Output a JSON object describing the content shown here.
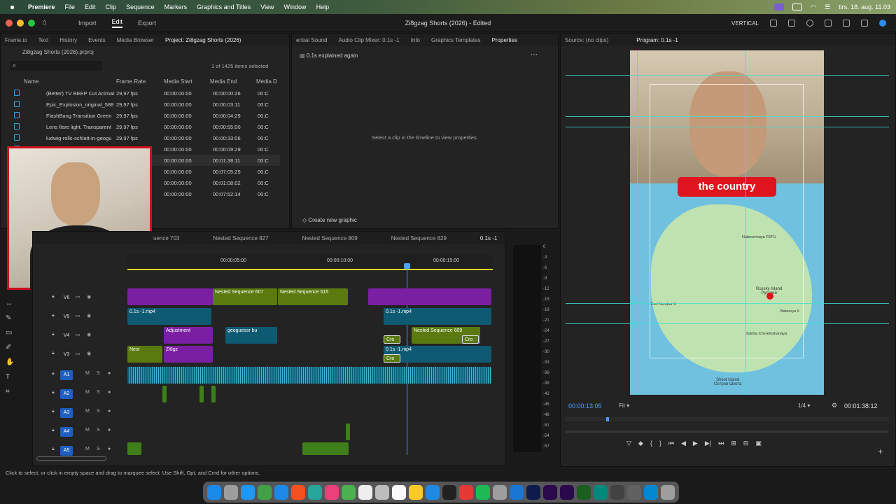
{
  "menubar": {
    "app_name": "Premiere",
    "items": [
      "File",
      "Edit",
      "Clip",
      "Sequence",
      "Markers",
      "Graphics and Titles",
      "View",
      "Window",
      "Help"
    ],
    "datetime": "tirs. 18. aug. 11.03"
  },
  "workspace": {
    "tabs": [
      "Import",
      "Edit",
      "Export"
    ],
    "active_tab": "Edit",
    "title": "Zi8gzag Shorts (2026) - Edited",
    "mode": "VERTICAL"
  },
  "project_panel": {
    "tabs": [
      "Frame.io",
      "Text",
      "History",
      "Events",
      "Media Browser",
      "Project: Zi8gzag Shorts (2026)"
    ],
    "project_file": "Zi8gzag Shorts (2026).prproj",
    "selection_info": "1 of 1425 items selected",
    "columns": [
      "Name",
      "Frame Rate",
      "Media Start",
      "Media End",
      "Media D"
    ],
    "rows": [
      {
        "name": "(Better) TV BEEP Cut Animat",
        "fps": "29,97 fps",
        "start": "00:00:00:00",
        "end": "00:00:00:26",
        "dur": "00:C"
      },
      {
        "name": "Epic_Explosion_original_588",
        "fps": "29,97 fps",
        "start": "00:00:00:00",
        "end": "00:00:03:11",
        "dur": "00:C"
      },
      {
        "name": "FlashBang Transition Green",
        "fps": "29,97 fps",
        "start": "00:00:00:00",
        "end": "00:00:04:29",
        "dur": "00:C"
      },
      {
        "name": "Lens flare light. Transparent",
        "fps": "29,97 fps",
        "start": "00:00:00:00",
        "end": "00:00:55:00",
        "dur": "00:C"
      },
      {
        "name": "ludwig-rolls-schlatt-in-geogu",
        "fps": "29,97 fps",
        "start": "00:00:00:00",
        "end": "00:00:33:06",
        "dur": "00:C"
      },
      {
        "name": "",
        "fps": "",
        "start": "00:00:00:00",
        "end": "00:00:09:29",
        "dur": "00:C"
      },
      {
        "name": "",
        "fps": "",
        "start": "00:00:00:00",
        "end": "00:01:38:11",
        "dur": "00:C"
      },
      {
        "name": "",
        "fps": "",
        "start": "00:00:00:00",
        "end": "00:07:05:25",
        "dur": "00:C"
      },
      {
        "name": "",
        "fps": "",
        "start": "00:00:00:00",
        "end": "00:01:08:02",
        "dur": "00:C"
      },
      {
        "name": "",
        "fps": "",
        "start": "00:00:00:00",
        "end": "00:07:52:14",
        "dur": "00:C"
      }
    ]
  },
  "properties_panel": {
    "tabs": [
      "ential Sound",
      "Audio Clip Mixer: 0.1s -1",
      "Info",
      "Graphics Templates",
      "Properties"
    ],
    "clip_name": "0.1s explained again",
    "message": "Select a clip in the timeline to view properties.",
    "create_graphic": "Create new graphic"
  },
  "source_panel": {
    "title": "Source: (no clips)"
  },
  "program_panel": {
    "title": "Program: 0.1s -1",
    "caption": "the country",
    "timecode": "00:00:13:05",
    "fit": "Fit",
    "resolution": "1/4",
    "duration": "00:01:38:12",
    "map_labels": [
      "Russky Island\nРусский",
      "Shkot Island\nОстров Шкота",
      "Nabrezhnaya FEFU",
      "Fort Number 6",
      "Batareya 9",
      "Bukhta Cheremshanaya"
    ]
  },
  "timeline": {
    "tabs": [
      "uence 703",
      "Nested Sequence 827",
      "Nested Sequence 809",
      "Nested Sequence 829",
      "0.1s -1"
    ],
    "ruler": [
      "00:00:05:00",
      "00:00:10:00",
      "00:00:15:00"
    ],
    "tracks": [
      "V6",
      "V5",
      "V4",
      "V3",
      "A1",
      "A2",
      "A3",
      "A4",
      "A5"
    ],
    "clips": {
      "v6_a": "Nested Sequence 607",
      "v6_b": "Nested Sequence 615",
      "v5_a": "0.1s -1.mp4",
      "v5_b": "0.1s -1.mp4",
      "v4_a": "Adjustment",
      "v4_b": "geoguessr bu",
      "v4_c": "Nested Sequence 609",
      "v3_a": "Nest",
      "v3_b": "Zi8gz",
      "v3_c": "0.1s -1.mp4",
      "cro1": "Cro",
      "cro2": "Cro",
      "cro3": "Cro"
    },
    "meter_labels": [
      "0",
      "-3",
      "-6",
      "-9",
      "-12",
      "-15",
      "-18",
      "-21",
      "-24",
      "-27",
      "-30",
      "-33",
      "-36",
      "-39",
      "-42",
      "-45",
      "-48",
      "-51",
      "-54",
      "-57"
    ]
  },
  "status_bar": "Click to select, or click in empty space and drag to marquee select. Use Shift, Opt, and Cmd for other options.",
  "colors": {
    "accent": "#2d8ceb",
    "clip_purple": "#7b1fa2",
    "clip_olive": "#5a7a10",
    "clip_teal": "#0f5a73",
    "caption_red": "#e0141e",
    "guide": "#3fe0d0"
  }
}
